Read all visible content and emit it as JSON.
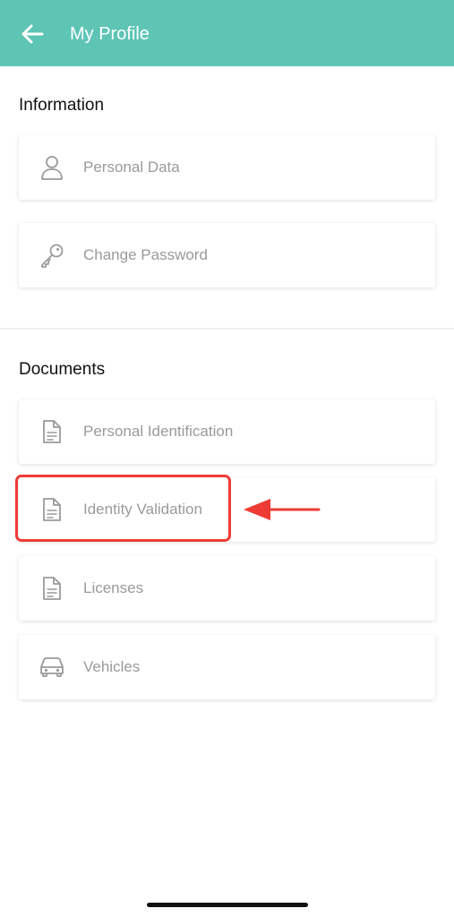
{
  "header": {
    "title": "My Profile",
    "back_icon": "arrow-left-icon",
    "background": "#5EC5B5"
  },
  "sections": [
    {
      "title": "Information",
      "items": [
        {
          "label": "Personal Data",
          "icon": "user-icon"
        },
        {
          "label": "Change Password",
          "icon": "key-icon"
        }
      ]
    },
    {
      "title": "Documents",
      "items": [
        {
          "label": "Personal Identification",
          "icon": "document-icon"
        },
        {
          "label": "Identity Validation",
          "icon": "document-icon"
        },
        {
          "label": "Licenses",
          "icon": "document-icon"
        },
        {
          "label": "Vehicles",
          "icon": "car-icon"
        }
      ]
    }
  ],
  "annotation": {
    "highlighted_item": "Identity Validation",
    "color": "#ee3b35"
  }
}
